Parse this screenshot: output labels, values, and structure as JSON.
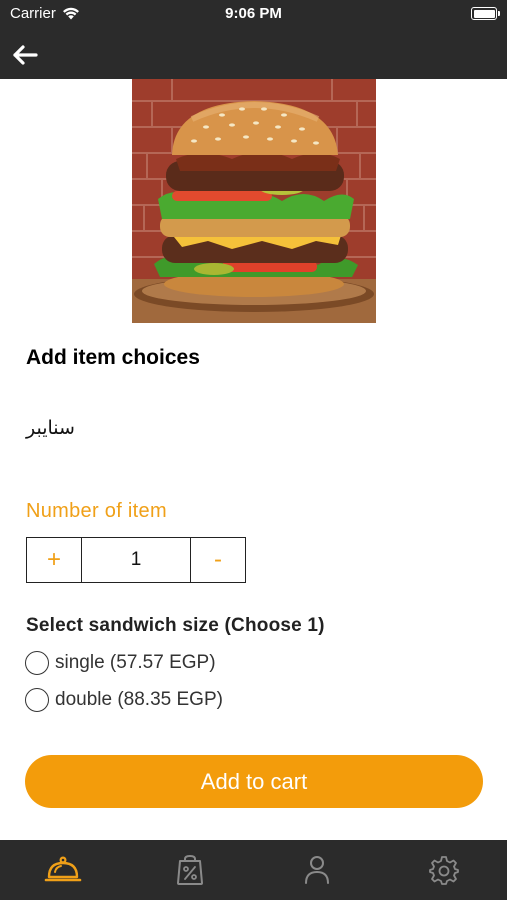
{
  "status_bar": {
    "carrier": "Carrier",
    "time": "9:06 PM"
  },
  "header": {
    "back_icon": "arrow-left-icon"
  },
  "hero_image": {
    "subject": "double cheeseburger"
  },
  "content": {
    "title": "Add item choices",
    "item_name": "سنايبر",
    "number_label": "Number of item",
    "quantity": {
      "plus": "+",
      "value": "1",
      "minus": "-"
    },
    "size_title": "Select sandwich size  (Choose 1)",
    "sizes": [
      {
        "label": "single (57.57 EGP)",
        "selected": false
      },
      {
        "label": "double (88.35 EGP)",
        "selected": false
      }
    ],
    "add_to_cart": "Add to cart"
  },
  "tabs": [
    {
      "icon": "food-cloche-icon",
      "active": true
    },
    {
      "icon": "discount-bag-icon",
      "active": false
    },
    {
      "icon": "user-icon",
      "active": false
    },
    {
      "icon": "settings-icon",
      "active": false
    }
  ],
  "colors": {
    "accent": "#f39c0b",
    "accent_text": "#f0a018",
    "bar_bg": "#2b2b2b",
    "tab_inactive": "#8a8a8a"
  }
}
